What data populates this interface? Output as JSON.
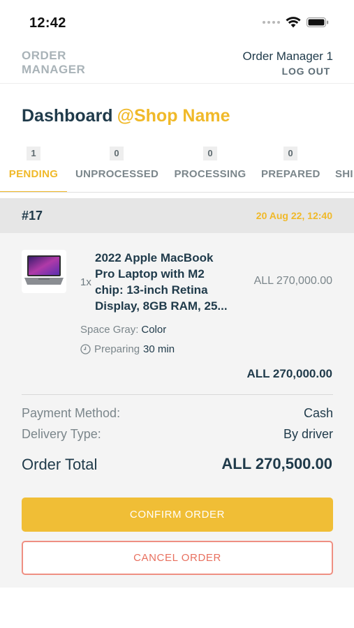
{
  "status_bar": {
    "time": "12:42"
  },
  "header": {
    "brand_line1": "ORDER",
    "brand_line2": "MANAGER",
    "manager_name": "Order Manager 1",
    "logout_label": "LOG OUT"
  },
  "dashboard": {
    "title": "Dashboard",
    "shop_name": "@Shop Name"
  },
  "tabs": [
    {
      "label": "PENDING",
      "count": "1",
      "active": true
    },
    {
      "label": "UNPROCESSED",
      "count": "0",
      "active": false
    },
    {
      "label": "PROCESSING",
      "count": "0",
      "active": false
    },
    {
      "label": "PREPARED",
      "count": "0",
      "active": false
    },
    {
      "label": "SHI",
      "count": "",
      "active": false
    }
  ],
  "order": {
    "number": "#17",
    "date": "20 Aug 22, 12:40",
    "item": {
      "quantity": "1x",
      "name_lines": [
        "2022 Apple MacBook",
        "Pro Laptop with M2",
        "chip: 13-inch Retina",
        "Display, 8GB RAM, 25..."
      ],
      "price": "ALL 270,000.00",
      "attribute_value": "Space Gray:",
      "attribute_label": "Color",
      "prep_label": "Preparing",
      "prep_time": "30 min",
      "line_total": "ALL 270,000.00"
    },
    "payment_method_label": "Payment Method:",
    "payment_method_value": "Cash",
    "delivery_type_label": "Delivery Type:",
    "delivery_type_value": "By driver",
    "total_label": "Order Total",
    "total_value": "ALL 270,500.00",
    "confirm_label": "CONFIRM ORDER",
    "cancel_label": "CANCEL ORDER"
  },
  "colors": {
    "accent": "#f0b929",
    "primary_text": "#1f3a4a",
    "secondary_text": "#7b868b",
    "cancel": "#e8705f"
  },
  "icons": [
    "wifi-icon",
    "battery-icon",
    "signal-icon",
    "clock-icon",
    "laptop-thumbnail"
  ]
}
